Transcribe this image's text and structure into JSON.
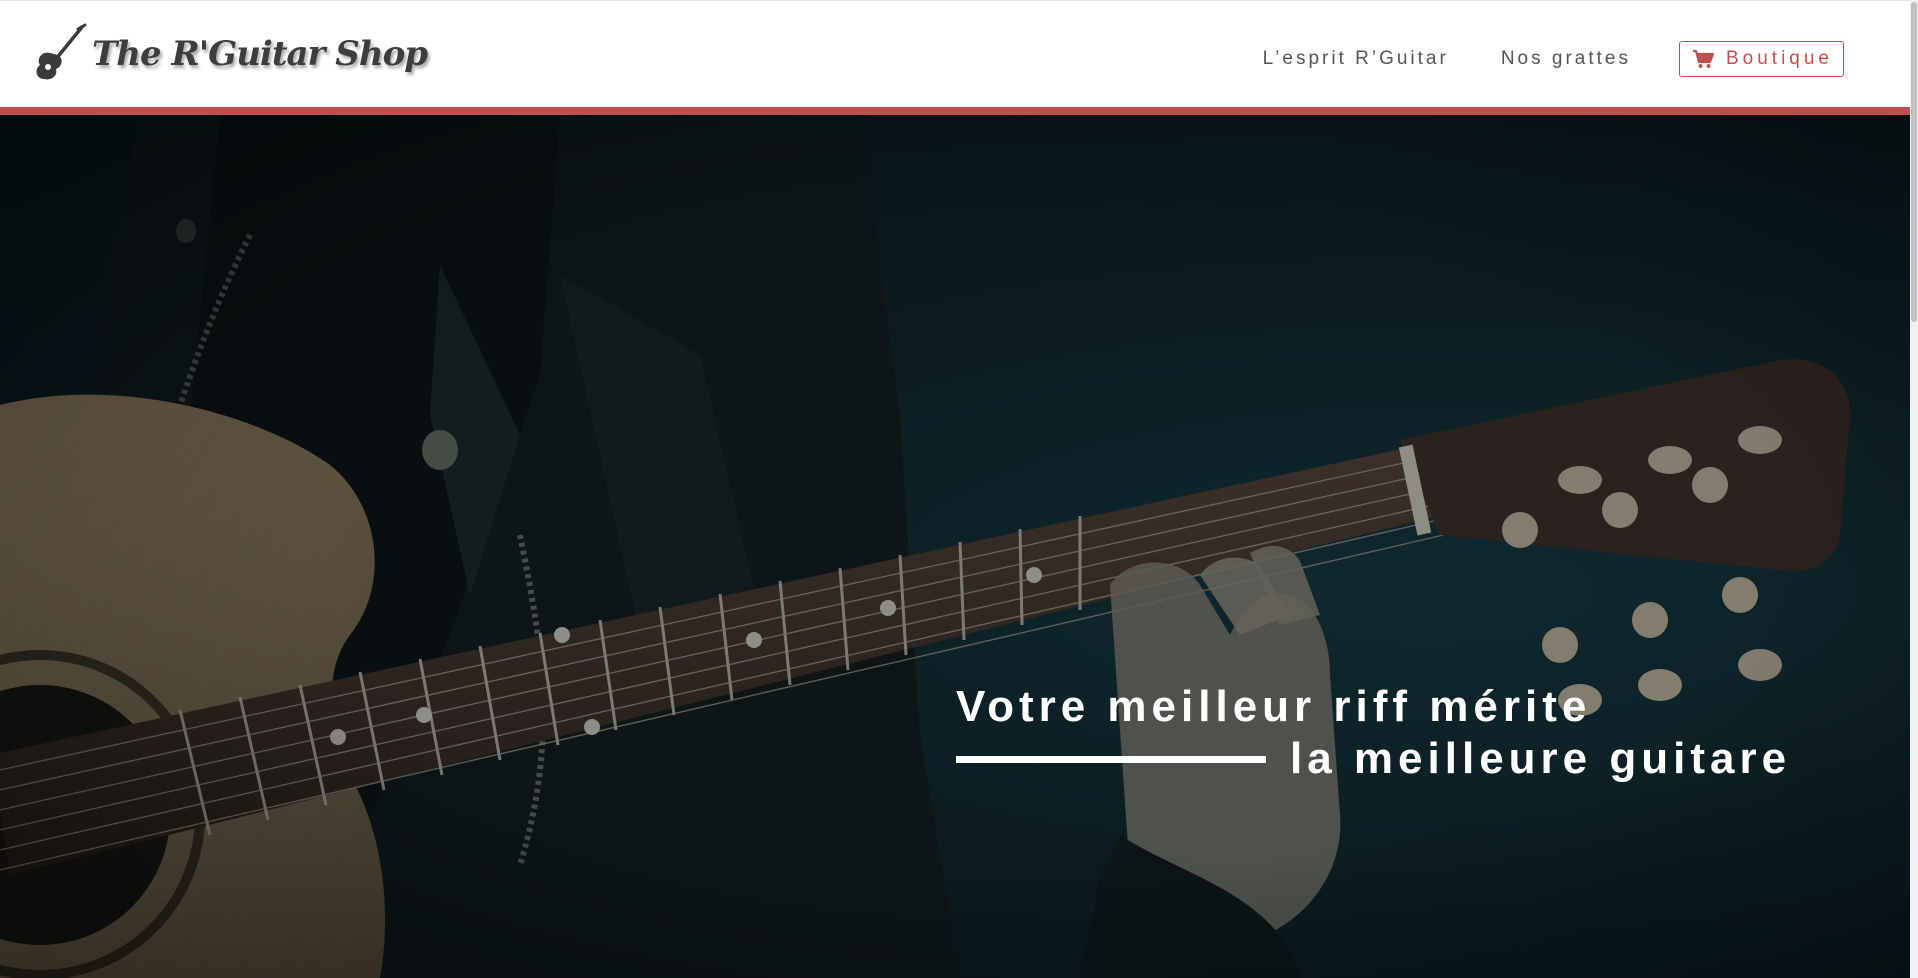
{
  "header": {
    "logo_text": "The R'Guitar Shop",
    "logo_icon": "guitar-icon"
  },
  "nav": {
    "items": [
      {
        "label": "L’esprit R’Guitar"
      },
      {
        "label": "Nos grattes"
      }
    ],
    "shop": {
      "label": "Boutique",
      "icon": "cart-icon"
    }
  },
  "hero": {
    "tagline_line1": "Votre meilleur riff mérite",
    "tagline_line2": "la meilleure guitare"
  },
  "colors": {
    "accent": "#c0504f",
    "hero_bg": "#0d2229",
    "nav_text": "#555555"
  }
}
